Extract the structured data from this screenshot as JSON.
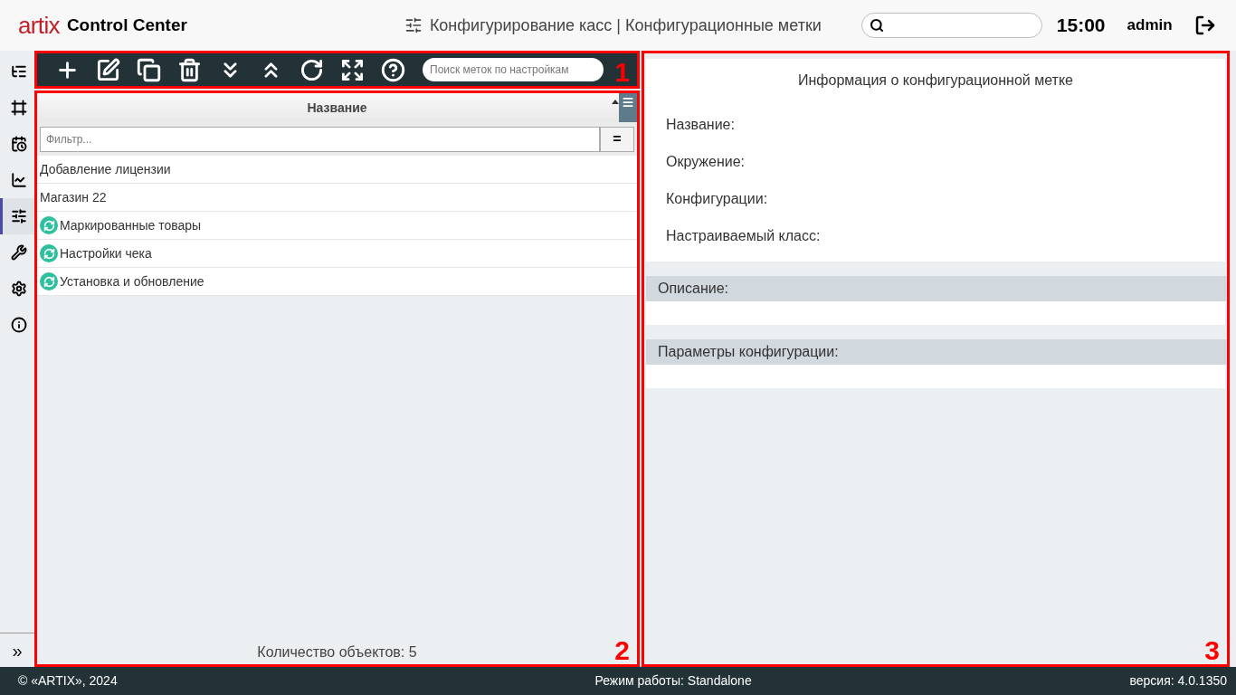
{
  "header": {
    "logo": "artix",
    "app_name": "Control Center",
    "page_title": "Конфигурирование касс | Конфигурационные метки",
    "time": "15:00",
    "user": "admin"
  },
  "sidebar": {
    "items": [
      {
        "kind": "tree",
        "selected": false
      },
      {
        "kind": "frame",
        "selected": false
      },
      {
        "kind": "calendar",
        "selected": false
      },
      {
        "kind": "chart",
        "selected": false
      },
      {
        "kind": "sliders",
        "selected": true
      },
      {
        "kind": "tools",
        "selected": false
      },
      {
        "kind": "gear",
        "selected": false
      },
      {
        "kind": "info",
        "selected": false
      }
    ],
    "expand": "»"
  },
  "toolbar": {
    "buttons": [
      {
        "kind": "add"
      },
      {
        "kind": "edit"
      },
      {
        "kind": "copy"
      },
      {
        "kind": "delete"
      },
      {
        "kind": "expand_all"
      },
      {
        "kind": "collapse_all"
      },
      {
        "kind": "refresh"
      },
      {
        "kind": "fullscreen"
      },
      {
        "kind": "help"
      }
    ],
    "search": {
      "placeholder": "Поиск меток по настройкам"
    },
    "annotation": "1"
  },
  "list": {
    "column": "Название",
    "filter": {
      "placeholder": "Фильтр...",
      "operator": "="
    },
    "rows": [
      {
        "name": "Добавление лицензии",
        "synced": false
      },
      {
        "name": "Магазин 22",
        "synced": false
      },
      {
        "name": "Маркированные товары",
        "synced": true
      },
      {
        "name": "Настройки чека",
        "synced": true
      },
      {
        "name": "Установка и обновление",
        "synced": true
      }
    ],
    "count": "Количество объектов: 5",
    "annotation": "2"
  },
  "details": {
    "title": "Информация о конфигурационной метке",
    "fields": [
      "Название:",
      "Окружение:",
      "Конфигурации:",
      "Настраиваемый класс:"
    ],
    "sections": [
      "Описание:",
      "Параметры конфигурации:"
    ],
    "annotation": "3"
  },
  "footer": {
    "copyright": "© «ARTIX», 2024",
    "mode": "Режим работы: Standalone",
    "version": "версия: 4.0.1350"
  }
}
